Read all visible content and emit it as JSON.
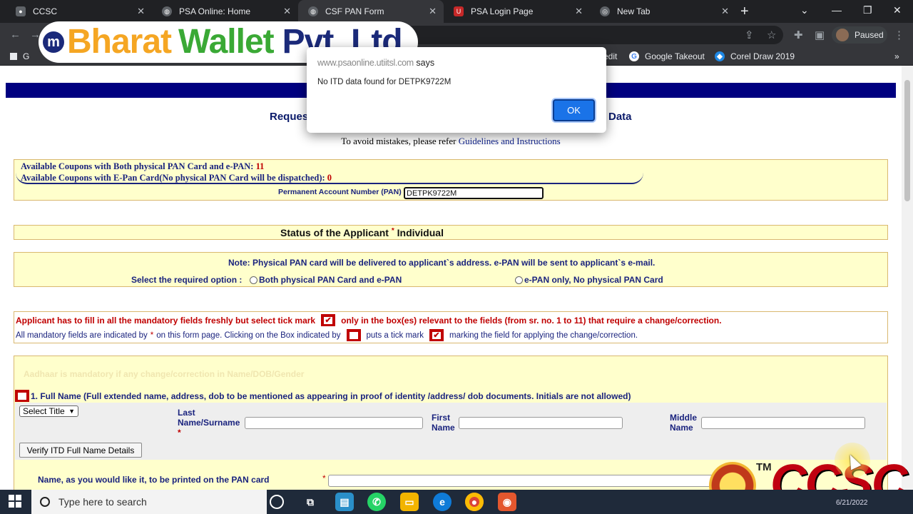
{
  "browser": {
    "tabs": [
      {
        "label": "CCSC",
        "color": "#5f6368",
        "icon": "ccsc-favicon"
      },
      {
        "label": "PSA Online: Home",
        "color": "#5f6368",
        "icon": "globe-icon"
      },
      {
        "label": "CSF PAN Form",
        "color": "#5f6368",
        "icon": "globe-icon"
      },
      {
        "label": "PSA Login Page",
        "color": "#c62828",
        "icon": "utiitsl-icon"
      },
      {
        "label": "New Tab",
        "color": "#5f6368",
        "icon": "chrome-icon"
      }
    ],
    "profile_label": "Paused",
    "bookmarks": [
      {
        "label": "G"
      },
      {
        "label": "edit"
      },
      {
        "label": "Google Takeout"
      },
      {
        "label": "Corel Draw 2019"
      }
    ]
  },
  "watermark": {
    "brand_part1": "Bharat",
    "brand_part2": "Wallet",
    "brand_part3": "Pvt. Ltd.",
    "brand_mark": "m",
    "ccsc_text": "CCSC",
    "tm": "TM"
  },
  "dialog": {
    "origin_blurred": "www.psaonline.utiitsl.com",
    "origin_says": "says",
    "message": "No ITD data found for DETPK9722M",
    "ok_label": "OK"
  },
  "page": {
    "title_left": "Reques",
    "title_right": "Data",
    "avoid_text": "To avoid mistakes, please refer",
    "guidelines_link": "Guidelines and Instructions",
    "coupons_both_label": "Available Coupons with Both physical PAN Card and e-PAN:",
    "coupons_both_value": "11",
    "coupons_epan_label": "Available Coupons with E-Pan Card(No physical PAN Card will be dispatched):",
    "coupons_epan_value": "0",
    "pan_label": "Permanent Account Number (PAN)",
    "pan_value": "DETPK9722M",
    "status_label": "Status of the Applicant",
    "status_value": "Individual",
    "note": "Note: Physical PAN card will be delivered to applicant`s address. e-PAN will be sent to applicant`s e-mail.",
    "select_option_label": "Select the required option :",
    "option_both": "Both physical PAN Card and e-PAN",
    "option_epan": "e-PAN only, No physical PAN Card",
    "warn_part1": "Applicant has to fill in all the mandatory fields freshly but select tick mark",
    "warn_part2": "only in the box(es) relevant to the fields (from sr. no. 1 to 11) that require a change/correction.",
    "mand_part1": "All mandatory fields are indicated by",
    "mand_part2": "on this form page. Clicking on the Box indicated by",
    "mand_part3": "puts a tick mark",
    "mand_part4": "marking the field for applying the change/correction.",
    "aadhaar_faded": "Aadhaar is mandatory if any change/correction in Name/DOB/Gender",
    "fullname_label": "1. Full Name (Full extended name, address, dob to be mentioned as appearing in proof of identity /address/ dob documents. Initials are not allowed)",
    "select_title": "Select Title",
    "last_name_label_1": "Last",
    "last_name_label_2": "Name/Surname",
    "first_name_label_1": "First",
    "first_name_label_2": "Name",
    "middle_name_label_1": "Middle",
    "middle_name_label_2": "Name",
    "verify_button": "Verify ITD Full Name Details",
    "print_name_label": "Name, as you would like it, to be printed on the PAN card",
    "required_star": "*"
  },
  "taskbar": {
    "search_placeholder": "Type here to search",
    "date": "6/21/2022"
  },
  "colors": {
    "header_bar": "#000080",
    "form_yellow": "#ffffcc",
    "required_red": "#c00000",
    "label_navy": "#1a237e",
    "ok_blue": "#1a73e8"
  }
}
